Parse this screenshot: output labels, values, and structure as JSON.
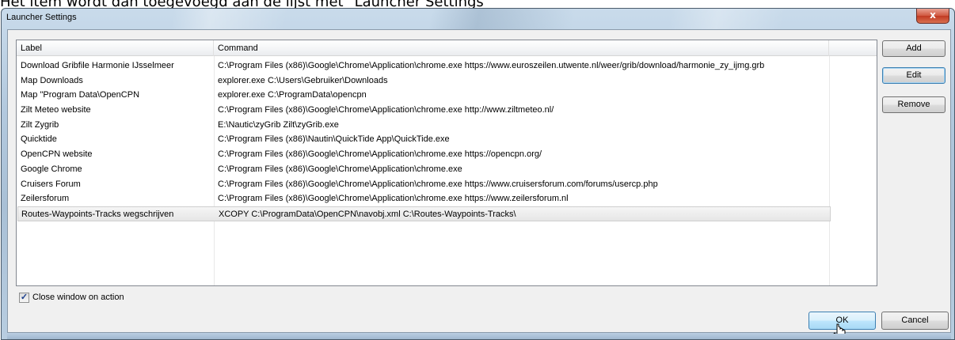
{
  "caption": "Het item wordt dan toegevoegd aan de lijst met \"Launcher Settings\"",
  "window": {
    "title": "Launcher Settings",
    "close_glyph": "x"
  },
  "list": {
    "columns": [
      "Label",
      "Command",
      ""
    ],
    "rows": [
      {
        "label": "Download Gribfile Harmonie IJsselmeer",
        "command": "C:\\Program Files (x86)\\Google\\Chrome\\Application\\chrome.exe https://www.euroszeilen.utwente.nl/weer/grib/download/harmonie_zy_ijmg.grb"
      },
      {
        "label": "Map Downloads",
        "command": "explorer.exe C:\\Users\\Gebruiker\\Downloads"
      },
      {
        "label": "Map \"Program Data\\OpenCPN",
        "command": "explorer.exe C:\\ProgramData\\opencpn"
      },
      {
        "label": "Zilt Meteo website",
        "command": "C:\\Program Files (x86)\\Google\\Chrome\\Application\\chrome.exe http://www.ziltmeteo.nl/"
      },
      {
        "label": "Zilt Zygrib",
        "command": "E:\\Nautic\\zyGrib Zilt\\zyGrib.exe"
      },
      {
        "label": "Quicktide",
        "command": "C:\\Program Files (x86)\\Nautin\\QuickTide App\\QuickTide.exe"
      },
      {
        "label": "OpenCPN website",
        "command": "C:\\Program Files (x86)\\Google\\Chrome\\Application\\chrome.exe https://opencpn.org/"
      },
      {
        "label": "Google Chrome",
        "command": "C:\\Program Files (x86)\\Google\\Chrome\\Application\\chrome.exe"
      },
      {
        "label": "Cruisers Forum",
        "command": "C:\\Program Files (x86)\\Google\\Chrome\\Application\\chrome.exe https://www.cruisersforum.com/forums/usercp.php"
      },
      {
        "label": "Zeilersforum",
        "command": "C:\\Program Files (x86)\\Google\\Chrome\\Application\\chrome.exe https://www.zeilersforum.nl"
      },
      {
        "label": "Routes-Waypoints-Tracks wegschrijven",
        "command": "XCOPY C:\\ProgramData\\OpenCPN\\navobj.xml C:\\Routes-Waypoints-Tracks\\"
      }
    ],
    "selected_index": 10
  },
  "buttons": {
    "add": "Add",
    "edit": "Edit",
    "remove": "Remove",
    "ok": "OK",
    "cancel": "Cancel"
  },
  "options": {
    "close_on_action_label": "Close window on action",
    "close_on_action_checked": true,
    "check_glyph": "✓"
  },
  "icons": {
    "cursor": "pointer-cursor-icon",
    "close": "close-icon",
    "check": "check-icon"
  }
}
